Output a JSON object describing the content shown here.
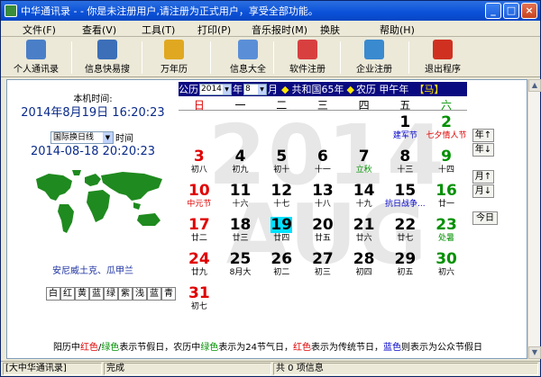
{
  "window": {
    "title": "中华通讯录 - - 你是未注册用户,请注册为正式用户，享受全部功能。",
    "controls": [
      "_",
      "□",
      "×"
    ]
  },
  "menu": [
    {
      "label": "文件(F)"
    },
    {
      "label": "查看(V)"
    },
    {
      "label": "工具(T)"
    },
    {
      "label": "打印(P)"
    },
    {
      "label": "音乐报时(M)"
    },
    {
      "label": "换肤"
    },
    {
      "label": "帮助(H)"
    }
  ],
  "toolbar": [
    {
      "label": "个人通讯录",
      "icon": "address-book-icon",
      "color": "#4a7fc8"
    },
    {
      "label": "信息快易搜",
      "icon": "search-person-icon",
      "color": "#3c6fb8"
    },
    {
      "label": "万年历",
      "icon": "calendar-icon",
      "color": "#e0a820"
    },
    {
      "label": "信息大全",
      "icon": "info-icon",
      "color": "#5a8fd8"
    },
    {
      "label": "软件注册",
      "icon": "register-icon",
      "color": "#d84040"
    },
    {
      "label": "企业注册",
      "icon": "company-icon",
      "color": "#3a8ad0"
    },
    {
      "label": "退出程序",
      "icon": "exit-icon",
      "color": "#d03020"
    }
  ],
  "left": {
    "local_time_caption": "本机时间:",
    "local_time": "2014年8月19日  16:20:23",
    "timezone": "国际换日线",
    "timezone_suffix": "时间",
    "timezone_time": "2014-08-18 20:20:23",
    "city": "安尼威土克、瓜甲兰",
    "color_buttons": [
      "白",
      "红",
      "黄",
      "蓝",
      "绿",
      "紫",
      "浅",
      "蓝",
      "青"
    ]
  },
  "calendar": {
    "gongli_label": "公历",
    "year": "2014",
    "year_unit": "年",
    "month": "8",
    "month_unit": "月",
    "republic": "共和国65年",
    "nongli": "农历 甲午年",
    "zodiac": "【马】",
    "diamond": "◆",
    "weekdays": [
      "日",
      "一",
      "二",
      "三",
      "四",
      "五",
      "六"
    ],
    "watermark_year": "2014",
    "watermark_month": "AUG",
    "days": [
      {
        "d": "1",
        "sub": "建军节",
        "col": 5,
        "row": 0,
        "color": "#000000",
        "subcolor": "#0000c8"
      },
      {
        "d": "2",
        "sub": "七夕情人节",
        "col": 6,
        "row": 0,
        "color": "#009000",
        "subcolor": "#e00000"
      },
      {
        "d": "3",
        "sub": "初八",
        "col": 0,
        "row": 1,
        "color": "#e00000",
        "subcolor": "#000000"
      },
      {
        "d": "4",
        "sub": "初九",
        "col": 1,
        "row": 1,
        "color": "#000000",
        "subcolor": "#000000"
      },
      {
        "d": "5",
        "sub": "初十",
        "col": 2,
        "row": 1,
        "color": "#000000",
        "subcolor": "#000000"
      },
      {
        "d": "6",
        "sub": "十一",
        "col": 3,
        "row": 1,
        "color": "#000000",
        "subcolor": "#000000"
      },
      {
        "d": "7",
        "sub": "立秋",
        "col": 4,
        "row": 1,
        "color": "#000000",
        "subcolor": "#009000"
      },
      {
        "d": "8",
        "sub": "十三",
        "col": 5,
        "row": 1,
        "color": "#000000",
        "subcolor": "#000000"
      },
      {
        "d": "9",
        "sub": "十四",
        "col": 6,
        "row": 1,
        "color": "#009000",
        "subcolor": "#000000"
      },
      {
        "d": "10",
        "sub": "中元节",
        "col": 0,
        "row": 2,
        "color": "#e00000",
        "subcolor": "#e00000"
      },
      {
        "d": "11",
        "sub": "十六",
        "col": 1,
        "row": 2,
        "color": "#000000",
        "subcolor": "#000000"
      },
      {
        "d": "12",
        "sub": "十七",
        "col": 2,
        "row": 2,
        "color": "#000000",
        "subcolor": "#000000"
      },
      {
        "d": "13",
        "sub": "十八",
        "col": 3,
        "row": 2,
        "color": "#000000",
        "subcolor": "#000000"
      },
      {
        "d": "14",
        "sub": "十九",
        "col": 4,
        "row": 2,
        "color": "#000000",
        "subcolor": "#000000"
      },
      {
        "d": "15",
        "sub": "抗日战争...",
        "col": 5,
        "row": 2,
        "color": "#000000",
        "subcolor": "#0000c8"
      },
      {
        "d": "16",
        "sub": "廿一",
        "col": 6,
        "row": 2,
        "color": "#009000",
        "subcolor": "#000000"
      },
      {
        "d": "17",
        "sub": "廿二",
        "col": 0,
        "row": 3,
        "color": "#e00000",
        "subcolor": "#000000"
      },
      {
        "d": "18",
        "sub": "廿三",
        "col": 1,
        "row": 3,
        "color": "#000000",
        "subcolor": "#000000"
      },
      {
        "d": "19",
        "sub": "廿四",
        "col": 2,
        "row": 3,
        "color": "#000000",
        "subcolor": "#000000",
        "today": true
      },
      {
        "d": "20",
        "sub": "廿五",
        "col": 3,
        "row": 3,
        "color": "#000000",
        "subcolor": "#000000"
      },
      {
        "d": "21",
        "sub": "廿六",
        "col": 4,
        "row": 3,
        "color": "#000000",
        "subcolor": "#000000"
      },
      {
        "d": "22",
        "sub": "廿七",
        "col": 5,
        "row": 3,
        "color": "#000000",
        "subcolor": "#000000"
      },
      {
        "d": "23",
        "sub": "处暑",
        "col": 6,
        "row": 3,
        "color": "#009000",
        "subcolor": "#009000"
      },
      {
        "d": "24",
        "sub": "廿九",
        "col": 0,
        "row": 4,
        "color": "#e00000",
        "subcolor": "#000000"
      },
      {
        "d": "25",
        "sub": "8月大",
        "col": 1,
        "row": 4,
        "color": "#000000",
        "subcolor": "#000000"
      },
      {
        "d": "26",
        "sub": "初二",
        "col": 2,
        "row": 4,
        "color": "#000000",
        "subcolor": "#000000"
      },
      {
        "d": "27",
        "sub": "初三",
        "col": 3,
        "row": 4,
        "color": "#000000",
        "subcolor": "#000000"
      },
      {
        "d": "28",
        "sub": "初四",
        "col": 4,
        "row": 4,
        "color": "#000000",
        "subcolor": "#000000"
      },
      {
        "d": "29",
        "sub": "初五",
        "col": 5,
        "row": 4,
        "color": "#000000",
        "subcolor": "#000000"
      },
      {
        "d": "30",
        "sub": "初六",
        "col": 6,
        "row": 4,
        "color": "#009000",
        "subcolor": "#000000"
      },
      {
        "d": "31",
        "sub": "初七",
        "col": 0,
        "row": 5,
        "color": "#e00000",
        "subcolor": "#000000"
      }
    ]
  },
  "side_buttons": {
    "year_up": "年↑",
    "year_down": "年↓",
    "month_up": "月↑",
    "month_down": "月↓",
    "today": "今日"
  },
  "legend": {
    "p1": "阳历中",
    "red1": "红色",
    "slash": "/",
    "green1": "绿色",
    "p2": "表示节假日，农历中",
    "green2": "绿色",
    "p3": "表示为24节气日，",
    "red2": "红色",
    "p4": "表示为传统节日，",
    "blue1": "蓝色",
    "p5": "则表示为公众节假日"
  },
  "status": {
    "pane1": "[大中华通讯录]",
    "pane2": "完成",
    "pane3": "共 0 项信息"
  }
}
